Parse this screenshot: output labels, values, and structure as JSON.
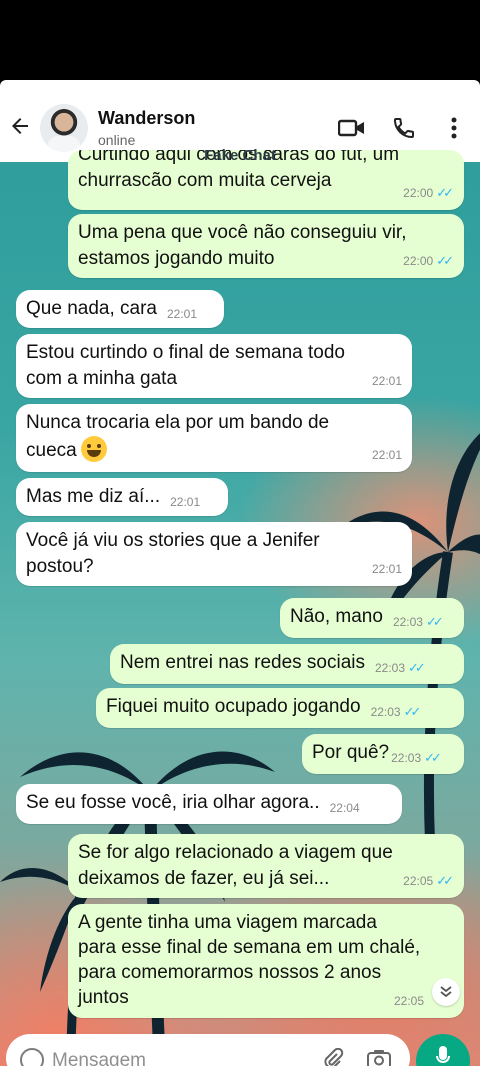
{
  "contact": {
    "name": "Wanderson",
    "status": "online"
  },
  "watermark": "Fake Chat",
  "colors": {
    "incoming": "#ffffff",
    "outgoing": "#e6ffd2",
    "accent": "#07a884",
    "read_ticks": "#34b7f1"
  },
  "messages": [
    {
      "dir": "out",
      "text": "Curtindo aqui com os caras do fut, um\nchurrascão com muita cerveja",
      "time": "22:00",
      "read": true
    },
    {
      "dir": "out",
      "text": "Uma pena que você não conseguiu vir,\nestamos jogando muito",
      "time": "22:00",
      "read": true
    },
    {
      "dir": "in",
      "text": "Que nada, cara",
      "time": "22:01"
    },
    {
      "dir": "in",
      "text": "Estou curtindo o final de semana todo\ncom a minha gata",
      "time": "22:01"
    },
    {
      "dir": "in",
      "text": "Nunca trocaria ela por um bando de\ncueca",
      "emoji": "grinning-sweat-emoji",
      "time": "22:01"
    },
    {
      "dir": "in",
      "text": "Mas me diz aí...",
      "time": "22:01"
    },
    {
      "dir": "in",
      "text": "Você já viu os stories que a Jenifer\npostou?",
      "time": "22:01"
    },
    {
      "dir": "out",
      "text": "Não, mano",
      "time": "22:03",
      "read": true
    },
    {
      "dir": "out",
      "text": "Nem entrei nas redes sociais",
      "time": "22:03",
      "read": true
    },
    {
      "dir": "out",
      "text": "Fiquei muito ocupado jogando",
      "time": "22:03",
      "read": true
    },
    {
      "dir": "out",
      "text": "Por quê?",
      "time": "22:03",
      "read": true
    },
    {
      "dir": "in",
      "text": "Se eu fosse você, iria olhar agora..",
      "time": "22:04"
    },
    {
      "dir": "out",
      "text": "Se for algo relacionado a viagem que\ndeixamos de fazer, eu já sei...",
      "time": "22:05",
      "read": true
    },
    {
      "dir": "out",
      "text": "A gente tinha uma viagem marcada\npara esse final de semana em um chalé,\npara comemorarmos nossos 2 anos\njuntos",
      "time": "22:05",
      "read": false
    }
  ],
  "composer": {
    "placeholder": "Mensagem"
  },
  "icons": {
    "back": "arrow-left-icon",
    "video": "video-camera-icon",
    "call": "phone-icon",
    "menu": "more-vertical-icon",
    "emoji": "smiley-icon",
    "attach": "paperclip-icon",
    "camera": "camera-icon",
    "mic": "microphone-icon",
    "scroll": "chevron-down-double-icon"
  }
}
